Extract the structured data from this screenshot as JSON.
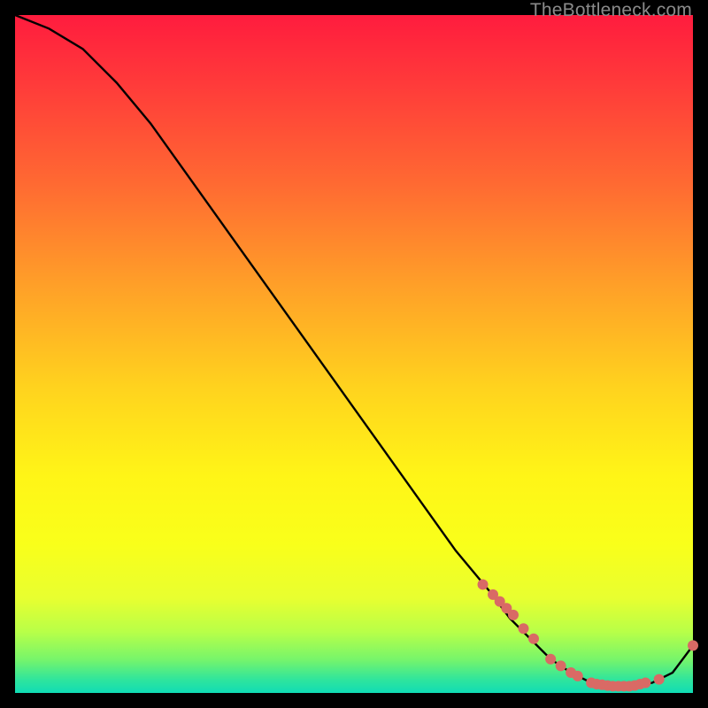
{
  "watermark": "TheBottleneck.com",
  "chart_data": {
    "type": "line",
    "title": "",
    "xlabel": "",
    "ylabel": "",
    "xlim": [
      0,
      100
    ],
    "ylim": [
      0,
      100
    ],
    "grid": false,
    "legend": false,
    "background": "rainbow-gradient-red-to-green",
    "series": [
      {
        "name": "curve",
        "x": [
          0,
          5,
          10,
          15,
          20,
          25,
          30,
          35,
          40,
          45,
          50,
          55,
          60,
          65,
          70,
          73,
          76,
          79,
          82,
          85,
          88,
          91,
          94,
          97,
          100
        ],
        "y": [
          100,
          98,
          95,
          90,
          84,
          77,
          70,
          63,
          56,
          49,
          42,
          35,
          28,
          21,
          15,
          11,
          8,
          5,
          3,
          1.5,
          1,
          1,
          1.5,
          3,
          7
        ]
      }
    ],
    "markers": [
      {
        "x": 69,
        "y": 16
      },
      {
        "x": 70.5,
        "y": 14.5
      },
      {
        "x": 71.5,
        "y": 13.5
      },
      {
        "x": 72.5,
        "y": 12.5
      },
      {
        "x": 73.5,
        "y": 11.5
      },
      {
        "x": 75,
        "y": 9.5
      },
      {
        "x": 76.5,
        "y": 8
      },
      {
        "x": 79,
        "y": 5
      },
      {
        "x": 80.5,
        "y": 4
      },
      {
        "x": 82,
        "y": 3
      },
      {
        "x": 83,
        "y": 2.5
      },
      {
        "x": 85,
        "y": 1.5
      },
      {
        "x": 85.8,
        "y": 1.3
      },
      {
        "x": 86.6,
        "y": 1.2
      },
      {
        "x": 87.4,
        "y": 1.1
      },
      {
        "x": 88.2,
        "y": 1.0
      },
      {
        "x": 89,
        "y": 1.0
      },
      {
        "x": 89.8,
        "y": 1.0
      },
      {
        "x": 90.6,
        "y": 1.0
      },
      {
        "x": 91.4,
        "y": 1.1
      },
      {
        "x": 92.2,
        "y": 1.3
      },
      {
        "x": 93,
        "y": 1.5
      },
      {
        "x": 95,
        "y": 2
      },
      {
        "x": 100,
        "y": 7
      }
    ],
    "marker_style": {
      "color": "#d96a65",
      "radius_px": 6
    }
  }
}
